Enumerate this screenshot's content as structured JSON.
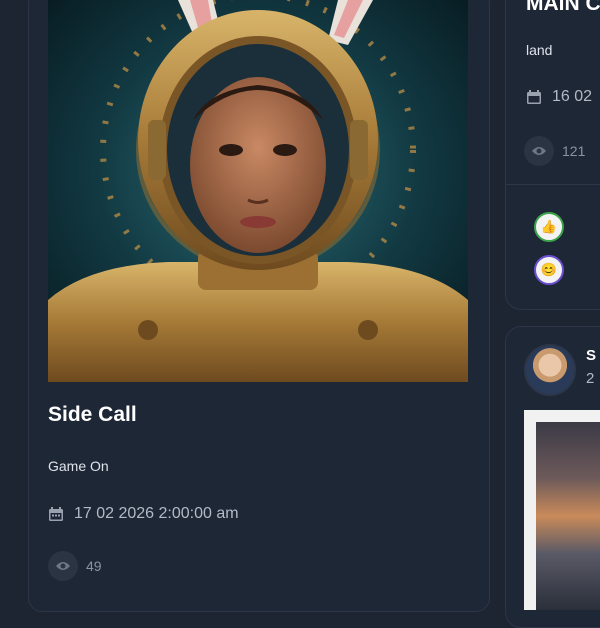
{
  "left_card": {
    "title": "Side Call",
    "subtitle": "Game On",
    "date": "17 02 2026 2:00:00 am",
    "views": "49",
    "image_icon": "astronaut-portrait-image"
  },
  "right_card": {
    "title": "MAIN C",
    "subtitle": "land",
    "date": "16 02",
    "views": "121",
    "reactions": [
      "thumbs-up-icon",
      "face-emoji-icon"
    ]
  },
  "post_card": {
    "user_initial": "S",
    "user_meta": "2"
  },
  "colors": {
    "background": "#1d2533",
    "card": "#1e2736",
    "text_muted": "#b3bac6"
  }
}
